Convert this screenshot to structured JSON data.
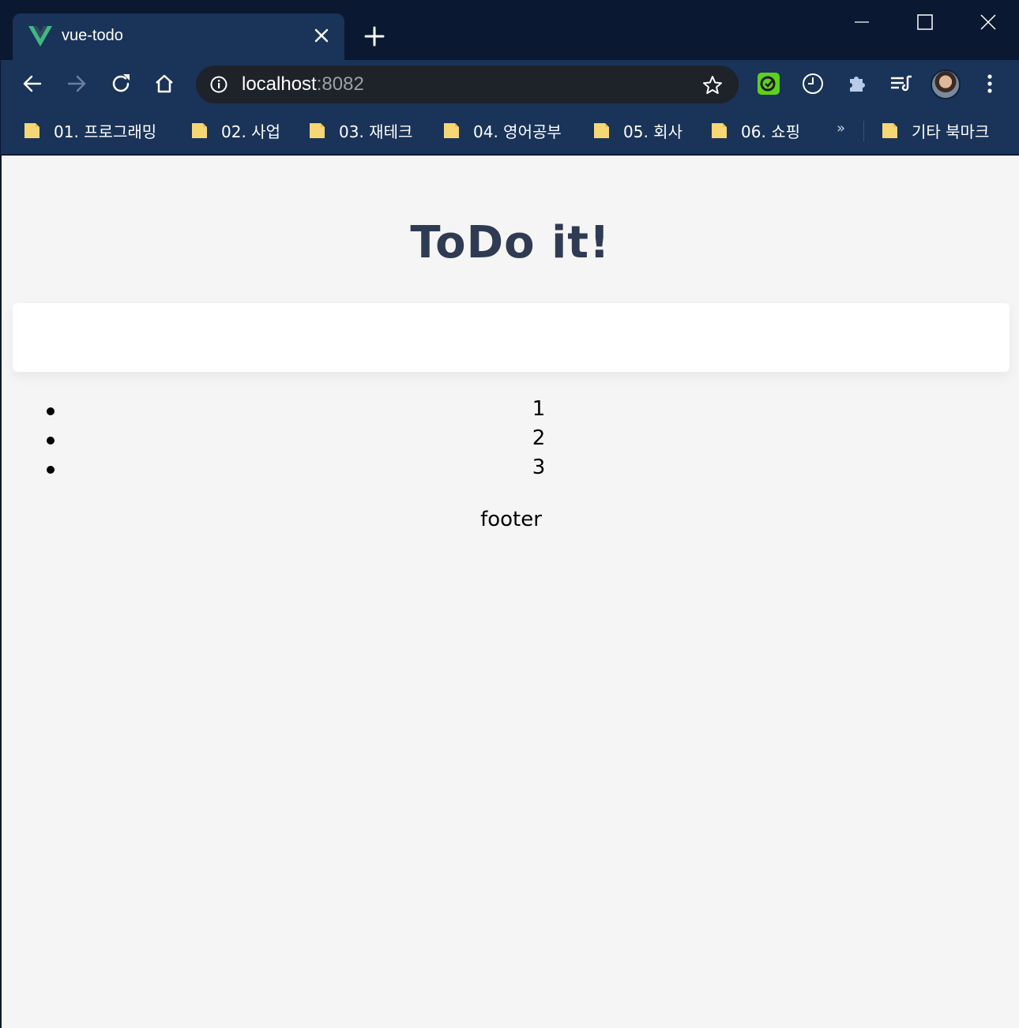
{
  "browser": {
    "tab": {
      "title": "vue-todo",
      "favicon": "vue-logo-icon"
    },
    "address": {
      "host": "localhost",
      "port": ":8082"
    },
    "bookmarks": [
      {
        "label": "01. 프로그래밍"
      },
      {
        "label": "02. 사업"
      },
      {
        "label": "03. 재테크"
      },
      {
        "label": "04. 영어공부"
      },
      {
        "label": "05. 회사"
      },
      {
        "label": "06. 쇼핑"
      }
    ],
    "bookmarks_overflow": "»",
    "other_bookmarks": "기타 북마크",
    "colors": {
      "frame": "#0a1832",
      "toolbar": "#1a3358",
      "omnibox": "#1e2229",
      "folder": "#f7d774"
    }
  },
  "page": {
    "title": "ToDo it!",
    "input_value": "",
    "todos": [
      "1",
      "2",
      "3"
    ],
    "footer": "footer",
    "colors": {
      "background": "#f5f5f5",
      "title": "#2f3b52"
    }
  }
}
